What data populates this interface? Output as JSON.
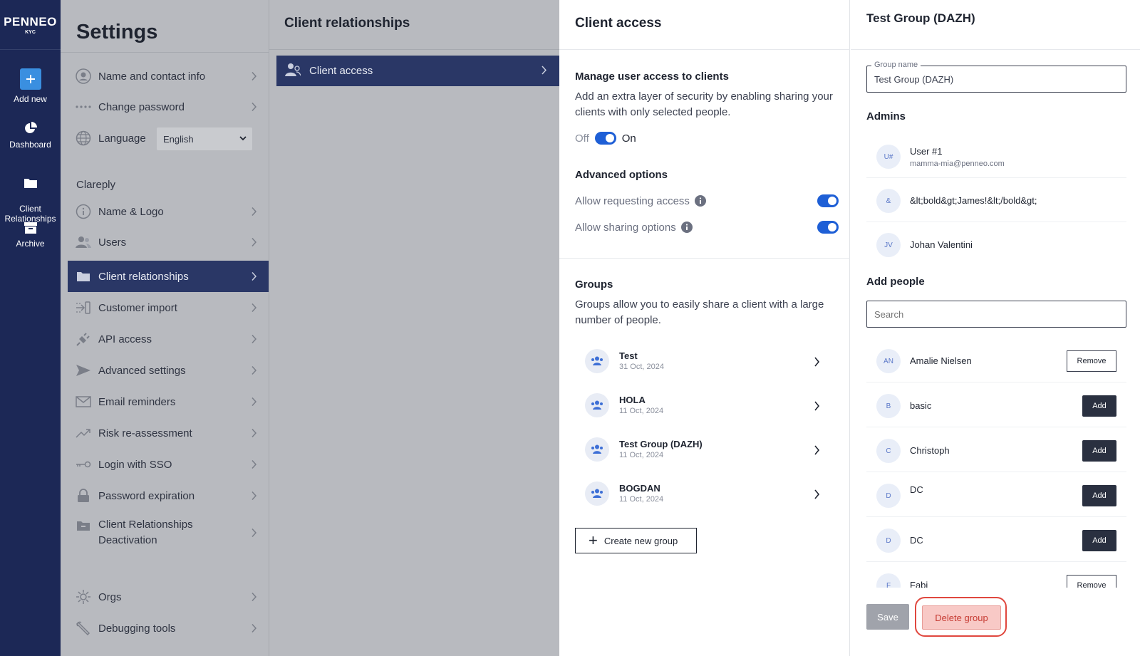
{
  "nav": {
    "logo_main": "PENNEO",
    "logo_sub": "KYC",
    "items": [
      {
        "label": "Add new",
        "icon": "plus-icon"
      },
      {
        "label": "Dashboard",
        "icon": "pie-chart-icon"
      },
      {
        "label": "Client\nRelationships",
        "icon": "folder-icon"
      },
      {
        "label": "Archive",
        "icon": "archive-icon"
      }
    ]
  },
  "settings": {
    "title": "Settings",
    "items": [
      {
        "label": "Name and contact info",
        "icon": "user-circle-icon"
      },
      {
        "label": "Change password",
        "icon": "password-dots-icon"
      },
      {
        "label": "Language",
        "icon": "globe-icon"
      }
    ],
    "language_value": "English",
    "section_label": "Clareply",
    "section_items": [
      {
        "label": "Name & Logo",
        "icon": "info-icon"
      },
      {
        "label": "Users",
        "icon": "users-icon"
      },
      {
        "label": "Client relationships",
        "icon": "folder-icon"
      },
      {
        "label": "Customer import",
        "icon": "import-icon"
      },
      {
        "label": "API access",
        "icon": "plug-icon"
      },
      {
        "label": "Advanced settings",
        "icon": "send-icon"
      },
      {
        "label": "Email reminders",
        "icon": "mail-icon"
      },
      {
        "label": "Risk re-assessment",
        "icon": "trend-icon"
      },
      {
        "label": "Login with SSO",
        "icon": "key-icon"
      },
      {
        "label": "Password expiration",
        "icon": "lock-icon"
      },
      {
        "label": "Client Relationships\nDeactivation",
        "icon": "folder-minus-icon"
      }
    ],
    "bottom_items": [
      {
        "label": "Orgs",
        "icon": "sun-icon"
      },
      {
        "label": "Debugging tools",
        "icon": "tool-icon"
      }
    ]
  },
  "client_relationships": {
    "title": "Client relationships",
    "item_label": "Client access"
  },
  "client_access": {
    "title": "Client access",
    "manage_heading": "Manage user access to clients",
    "manage_text": "Add an extra layer of security by enabling sharing your clients with only selected people.",
    "toggle_off": "Off",
    "toggle_on": "On",
    "advanced_heading": "Advanced options",
    "option_requesting": "Allow requesting access",
    "option_sharing": "Allow sharing options",
    "groups_heading": "Groups",
    "groups_text": "Groups allow you to easily share a client with a large number of people.",
    "groups": [
      {
        "name": "Test",
        "date": "31 Oct, 2024"
      },
      {
        "name": "HOLA",
        "date": "11 Oct, 2024"
      },
      {
        "name": "Test Group (DAZH)",
        "date": "11 Oct, 2024"
      },
      {
        "name": "BOGDAN",
        "date": "11 Oct, 2024"
      }
    ],
    "create_label": "Create new group"
  },
  "group_detail": {
    "title": "Test Group (DAZH)",
    "group_name_label": "Group name",
    "group_name_value": "Test Group (DAZH)",
    "admins_heading": "Admins",
    "admins": [
      {
        "initials": "U#",
        "name": "User #1",
        "email": "mamma-mia@penneo.com"
      },
      {
        "initials": "&",
        "name": "&lt;bold&gt;James!&lt;/bold&gt;"
      },
      {
        "initials": "JV",
        "name": "Johan Valentini"
      }
    ],
    "add_people_heading": "Add people",
    "search_placeholder": "Search",
    "people": [
      {
        "initials": "AN",
        "name": "Amalie Nielsen",
        "action": "Remove"
      },
      {
        "initials": "B",
        "name": "basic",
        "action": "Add"
      },
      {
        "initials": "C",
        "name": "Christoph",
        "action": "Add"
      },
      {
        "initials": "D",
        "name": "DC",
        "action": "Add"
      },
      {
        "initials": "D",
        "name": "DC",
        "action": "Add"
      },
      {
        "initials": "F",
        "name": "Fabi",
        "action": "Remove"
      }
    ],
    "save_label": "Save",
    "delete_label": "Delete group"
  },
  "colors": {
    "nav_bg": "#1c2856",
    "active_item_bg": "#2a3766",
    "toggle_on": "#1e5fd6",
    "delete_highlight": "#e0473e"
  }
}
